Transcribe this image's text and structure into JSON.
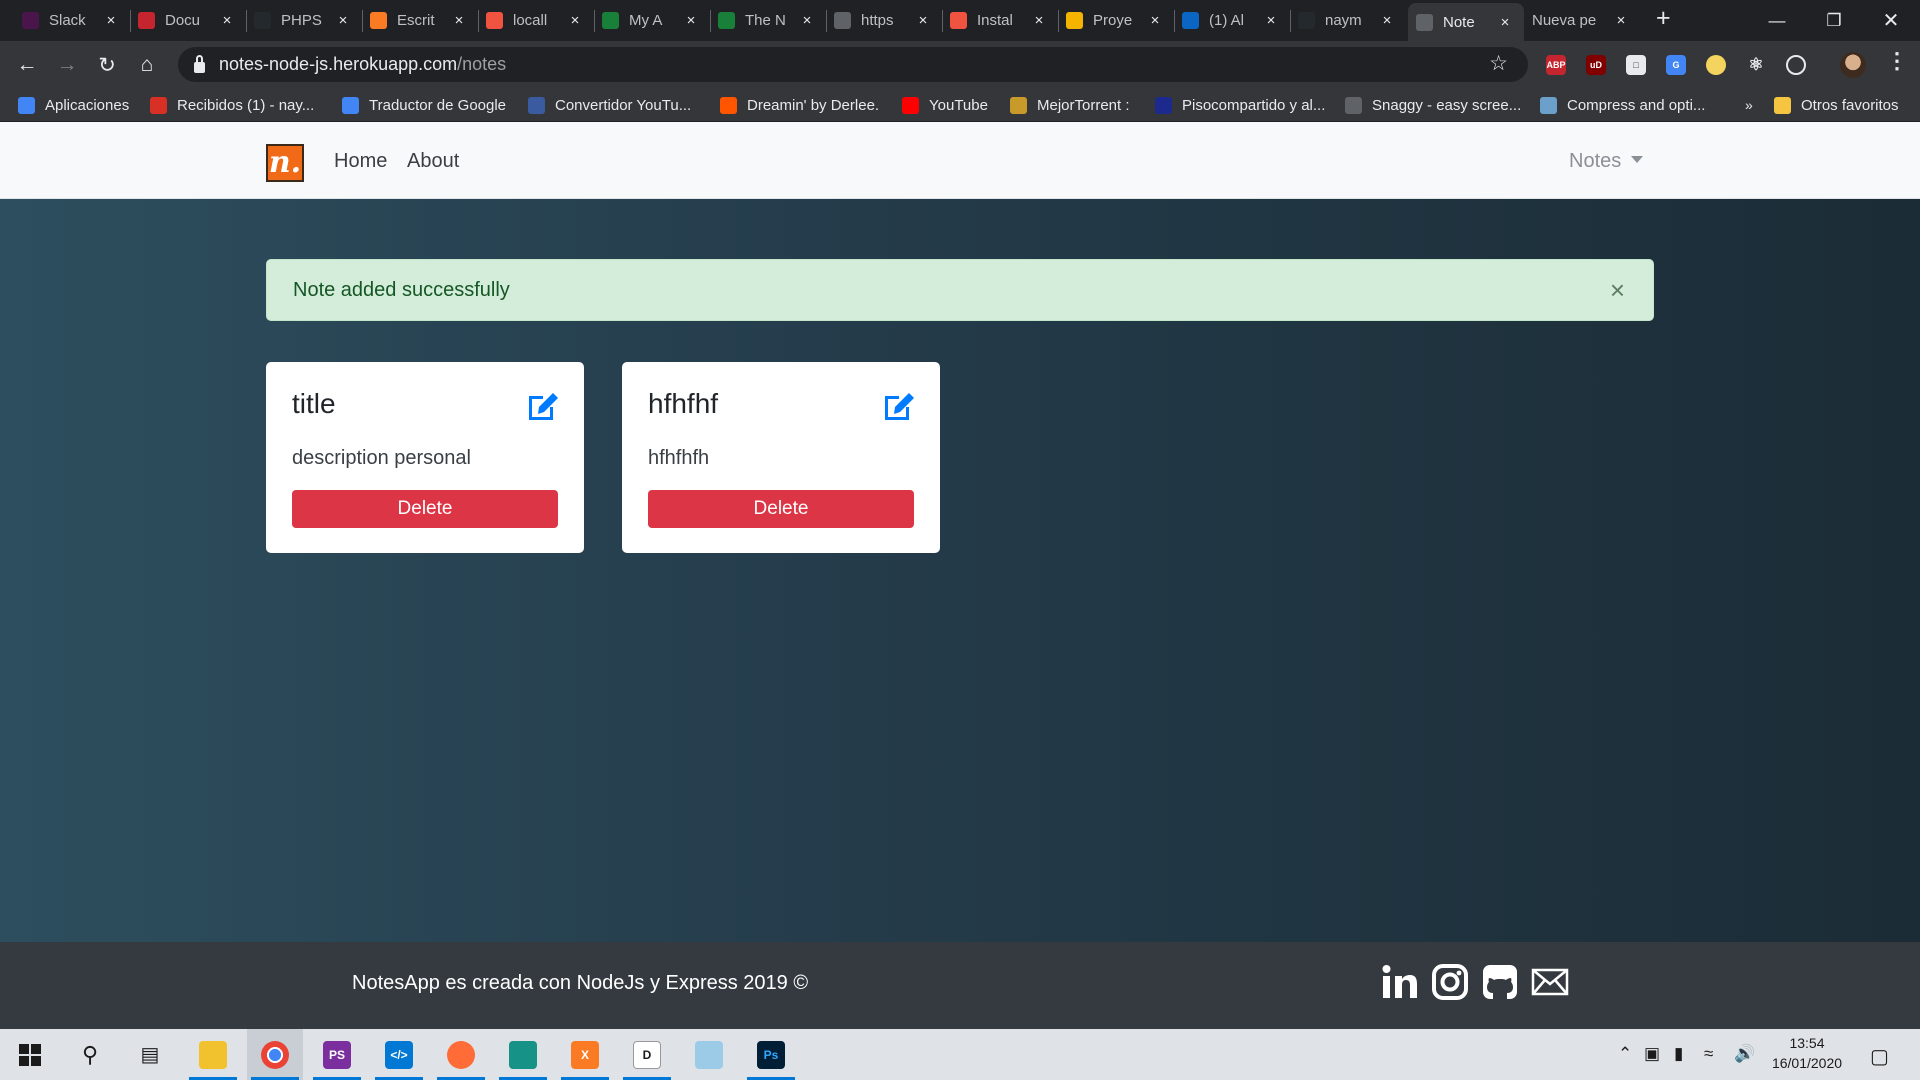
{
  "browser": {
    "tabs": [
      {
        "title": "Slack",
        "icon": "slack-icon",
        "color": "#4a154b"
      },
      {
        "title": "Docu",
        "icon": "pdf-icon",
        "color": "#c4252f"
      },
      {
        "title": "PHPS",
        "icon": "github-icon",
        "color": "#24292e"
      },
      {
        "title": "Escrit",
        "icon": "xampp-icon",
        "color": "#fb7a24"
      },
      {
        "title": "locall",
        "icon": "laravel-icon",
        "color": "#f05340"
      },
      {
        "title": "My A",
        "icon": "sheet-icon",
        "color": "#188038"
      },
      {
        "title": "The N",
        "icon": "sheet-icon",
        "color": "#188038"
      },
      {
        "title": "https",
        "icon": "globe-icon",
        "color": "#5f6368"
      },
      {
        "title": "Instal",
        "icon": "laravel-icon",
        "color": "#f05340"
      },
      {
        "title": "Proye",
        "icon": "slides-icon",
        "color": "#f4b400"
      },
      {
        "title": "(1) Al",
        "icon": "linkedin-icon",
        "color": "#0a66c2"
      },
      {
        "title": "naym",
        "icon": "github-icon",
        "color": "#24292e"
      },
      {
        "title": "Note",
        "icon": "globe-icon",
        "color": "#5f6368",
        "active": true
      },
      {
        "title": "Nueva pe",
        "icon": "none",
        "color": "#35363a"
      }
    ],
    "url_host": "notes-node-js.herokuapp.com",
    "url_path": "/notes",
    "bookmarks": [
      {
        "label": "Aplicaciones",
        "icon": "apps-grid-icon",
        "color": "#4285f4"
      },
      {
        "label": "Recibidos (1) - nay...",
        "icon": "gmail-icon",
        "color": "#d93025"
      },
      {
        "label": "Traductor de Google",
        "icon": "translate-icon",
        "color": "#4285f4"
      },
      {
        "label": "Convertidor YouTu...",
        "icon": "converter-icon",
        "color": "#3a5ba0"
      },
      {
        "label": "Dreamin' by Derlee.",
        "icon": "soundcloud-icon",
        "color": "#ff5500"
      },
      {
        "label": "YouTube",
        "icon": "youtube-icon",
        "color": "#ff0000"
      },
      {
        "label": "MejorTorrent :",
        "icon": "torrent-icon",
        "color": "#c79a2a"
      },
      {
        "label": "Pisocompartido y al...",
        "icon": "p-icon",
        "color": "#1b2a8c"
      },
      {
        "label": "Snaggy - easy scree...",
        "icon": "sg-icon",
        "color": "#5f6368"
      },
      {
        "label": "Compress and opti...",
        "icon": "compress-icon",
        "color": "#6aa0c9"
      }
    ],
    "bookmarks_overflow": "»",
    "other_bookmarks": "Otros favoritos"
  },
  "app": {
    "brand_letter": "n.",
    "nav": {
      "home": "Home",
      "about": "About",
      "notes_dropdown": "Notes"
    },
    "alert": {
      "message": "Note added successfully",
      "close": "×"
    },
    "notes": [
      {
        "title": "title",
        "description": "description personal",
        "delete_label": "Delete"
      },
      {
        "title": "hfhfhf",
        "description": "hfhfhfh",
        "delete_label": "Delete"
      }
    ],
    "footer": {
      "text": "NotesApp es creada con NodeJs y Express 2019 ©"
    },
    "colors": {
      "alert_bg": "#d4edda",
      "alert_text": "#155724",
      "danger": "#dc3545",
      "edit_icon": "#007bff",
      "footer_bg": "#343a40",
      "brand": "#f06a17"
    }
  },
  "taskbar": {
    "time": "13:54",
    "date": "16/01/2020"
  }
}
